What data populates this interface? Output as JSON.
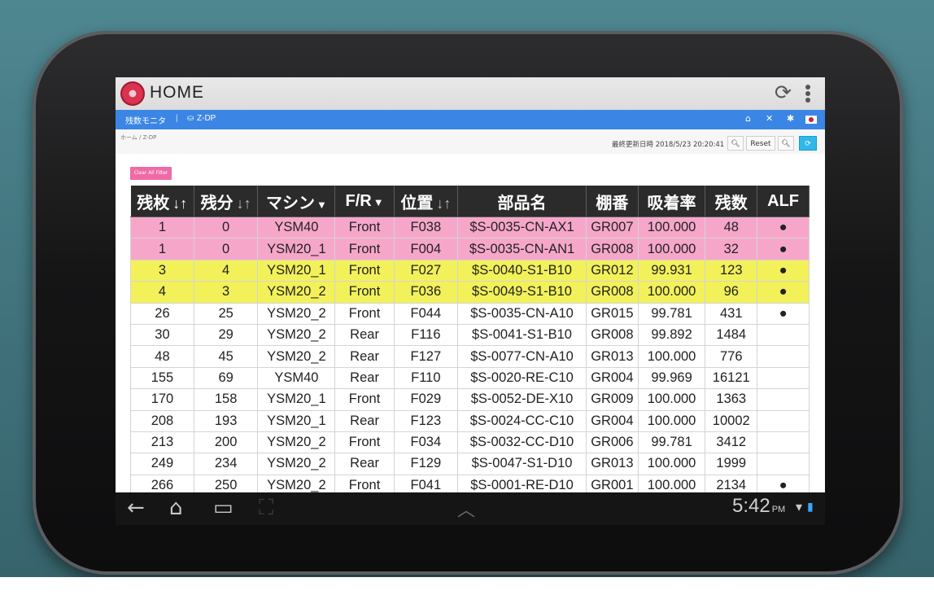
{
  "app": {
    "title": "HOME"
  },
  "nav": {
    "section": "残数モニタ",
    "separator": "|",
    "machine_icon": "machine-icon",
    "machine": "Z-DP"
  },
  "breadcrumb": "ホーム / Z-DP",
  "toolbar": {
    "last_updated": "最終更新日時 2018/5/23 20:20:41",
    "reset_label": "Reset"
  },
  "clear_filter_label": "Clear All Filter",
  "table": {
    "headers": [
      "残枚",
      "残分",
      "マシン",
      "F/R",
      "位置",
      "部品名",
      "棚番",
      "吸着率",
      "残数",
      "ALF"
    ],
    "rows": [
      {
        "zanmai": "1",
        "zanbun": "0",
        "machine": "YSM40",
        "fr": "Front",
        "pos": "F038",
        "part": "$S-0035-CN-AX1",
        "shelf": "GR007",
        "rate": "100.000",
        "count": "48",
        "alf": "●",
        "hl": "pink"
      },
      {
        "zanmai": "1",
        "zanbun": "0",
        "machine": "YSM20_1",
        "fr": "Front",
        "pos": "F004",
        "part": "$S-0035-CN-AN1",
        "shelf": "GR008",
        "rate": "100.000",
        "count": "32",
        "alf": "●",
        "hl": "pink"
      },
      {
        "zanmai": "3",
        "zanbun": "4",
        "machine": "YSM20_1",
        "fr": "Front",
        "pos": "F027",
        "part": "$S-0040-S1-B10",
        "shelf": "GR012",
        "rate": "99.931",
        "count": "123",
        "alf": "●",
        "hl": "yellow"
      },
      {
        "zanmai": "4",
        "zanbun": "3",
        "machine": "YSM20_2",
        "fr": "Front",
        "pos": "F036",
        "part": "$S-0049-S1-B10",
        "shelf": "GR008",
        "rate": "100.000",
        "count": "96",
        "alf": "●",
        "hl": "yellow"
      },
      {
        "zanmai": "26",
        "zanbun": "25",
        "machine": "YSM20_2",
        "fr": "Front",
        "pos": "F044",
        "part": "$S-0035-CN-A10",
        "shelf": "GR015",
        "rate": "99.781",
        "count": "431",
        "alf": "●",
        "hl": ""
      },
      {
        "zanmai": "30",
        "zanbun": "29",
        "machine": "YSM20_2",
        "fr": "Rear",
        "pos": "F116",
        "part": "$S-0041-S1-B10",
        "shelf": "GR008",
        "rate": "99.892",
        "count": "1484",
        "alf": "",
        "hl": ""
      },
      {
        "zanmai": "48",
        "zanbun": "45",
        "machine": "YSM20_2",
        "fr": "Rear",
        "pos": "F127",
        "part": "$S-0077-CN-A10",
        "shelf": "GR013",
        "rate": "100.000",
        "count": "776",
        "alf": "",
        "hl": ""
      },
      {
        "zanmai": "155",
        "zanbun": "69",
        "machine": "YSM40",
        "fr": "Rear",
        "pos": "F110",
        "part": "$S-0020-RE-C10",
        "shelf": "GR004",
        "rate": "99.969",
        "count": "16121",
        "alf": "",
        "hl": ""
      },
      {
        "zanmai": "170",
        "zanbun": "158",
        "machine": "YSM20_1",
        "fr": "Front",
        "pos": "F029",
        "part": "$S-0052-DE-X10",
        "shelf": "GR009",
        "rate": "100.000",
        "count": "1363",
        "alf": "",
        "hl": ""
      },
      {
        "zanmai": "208",
        "zanbun": "193",
        "machine": "YSM20_1",
        "fr": "Rear",
        "pos": "F123",
        "part": "$S-0024-CC-C10",
        "shelf": "GR004",
        "rate": "100.000",
        "count": "10002",
        "alf": "",
        "hl": ""
      },
      {
        "zanmai": "213",
        "zanbun": "200",
        "machine": "YSM20_2",
        "fr": "Front",
        "pos": "F034",
        "part": "$S-0032-CC-D10",
        "shelf": "GR006",
        "rate": "99.781",
        "count": "3412",
        "alf": "",
        "hl": ""
      },
      {
        "zanmai": "249",
        "zanbun": "234",
        "machine": "YSM20_2",
        "fr": "Rear",
        "pos": "F129",
        "part": "$S-0047-S1-D10",
        "shelf": "GR013",
        "rate": "100.000",
        "count": "1999",
        "alf": "",
        "hl": ""
      },
      {
        "zanmai": "266",
        "zanbun": "250",
        "machine": "YSM20_2",
        "fr": "Front",
        "pos": "F041",
        "part": "$S-0001-RE-D10",
        "shelf": "GR001",
        "rate": "100.000",
        "count": "2134",
        "alf": "●",
        "hl": ""
      }
    ]
  },
  "status_bar": {
    "time": "5:42",
    "ampm": "PM"
  },
  "colors": {
    "navbar": "#3b86e4",
    "pink_row": "#f6a7c9",
    "yellow_row": "#f2f15a",
    "header": "#2b2b2b",
    "clear_button": "#f06aa5",
    "refresh_button": "#30b8e9"
  },
  "icons": [
    "app-logo-icon",
    "refresh-icon",
    "overflow-menu-icon",
    "home-icon",
    "expand-icon",
    "settings-icon",
    "flag-jp-icon",
    "search-icon",
    "search-icon",
    "auto-refresh-icon",
    "sort-icon",
    "filter-icon",
    "back-icon",
    "home-nav-icon",
    "recents-icon",
    "screenshot-icon",
    "chevron-up-icon",
    "wifi-icon",
    "battery-icon"
  ]
}
